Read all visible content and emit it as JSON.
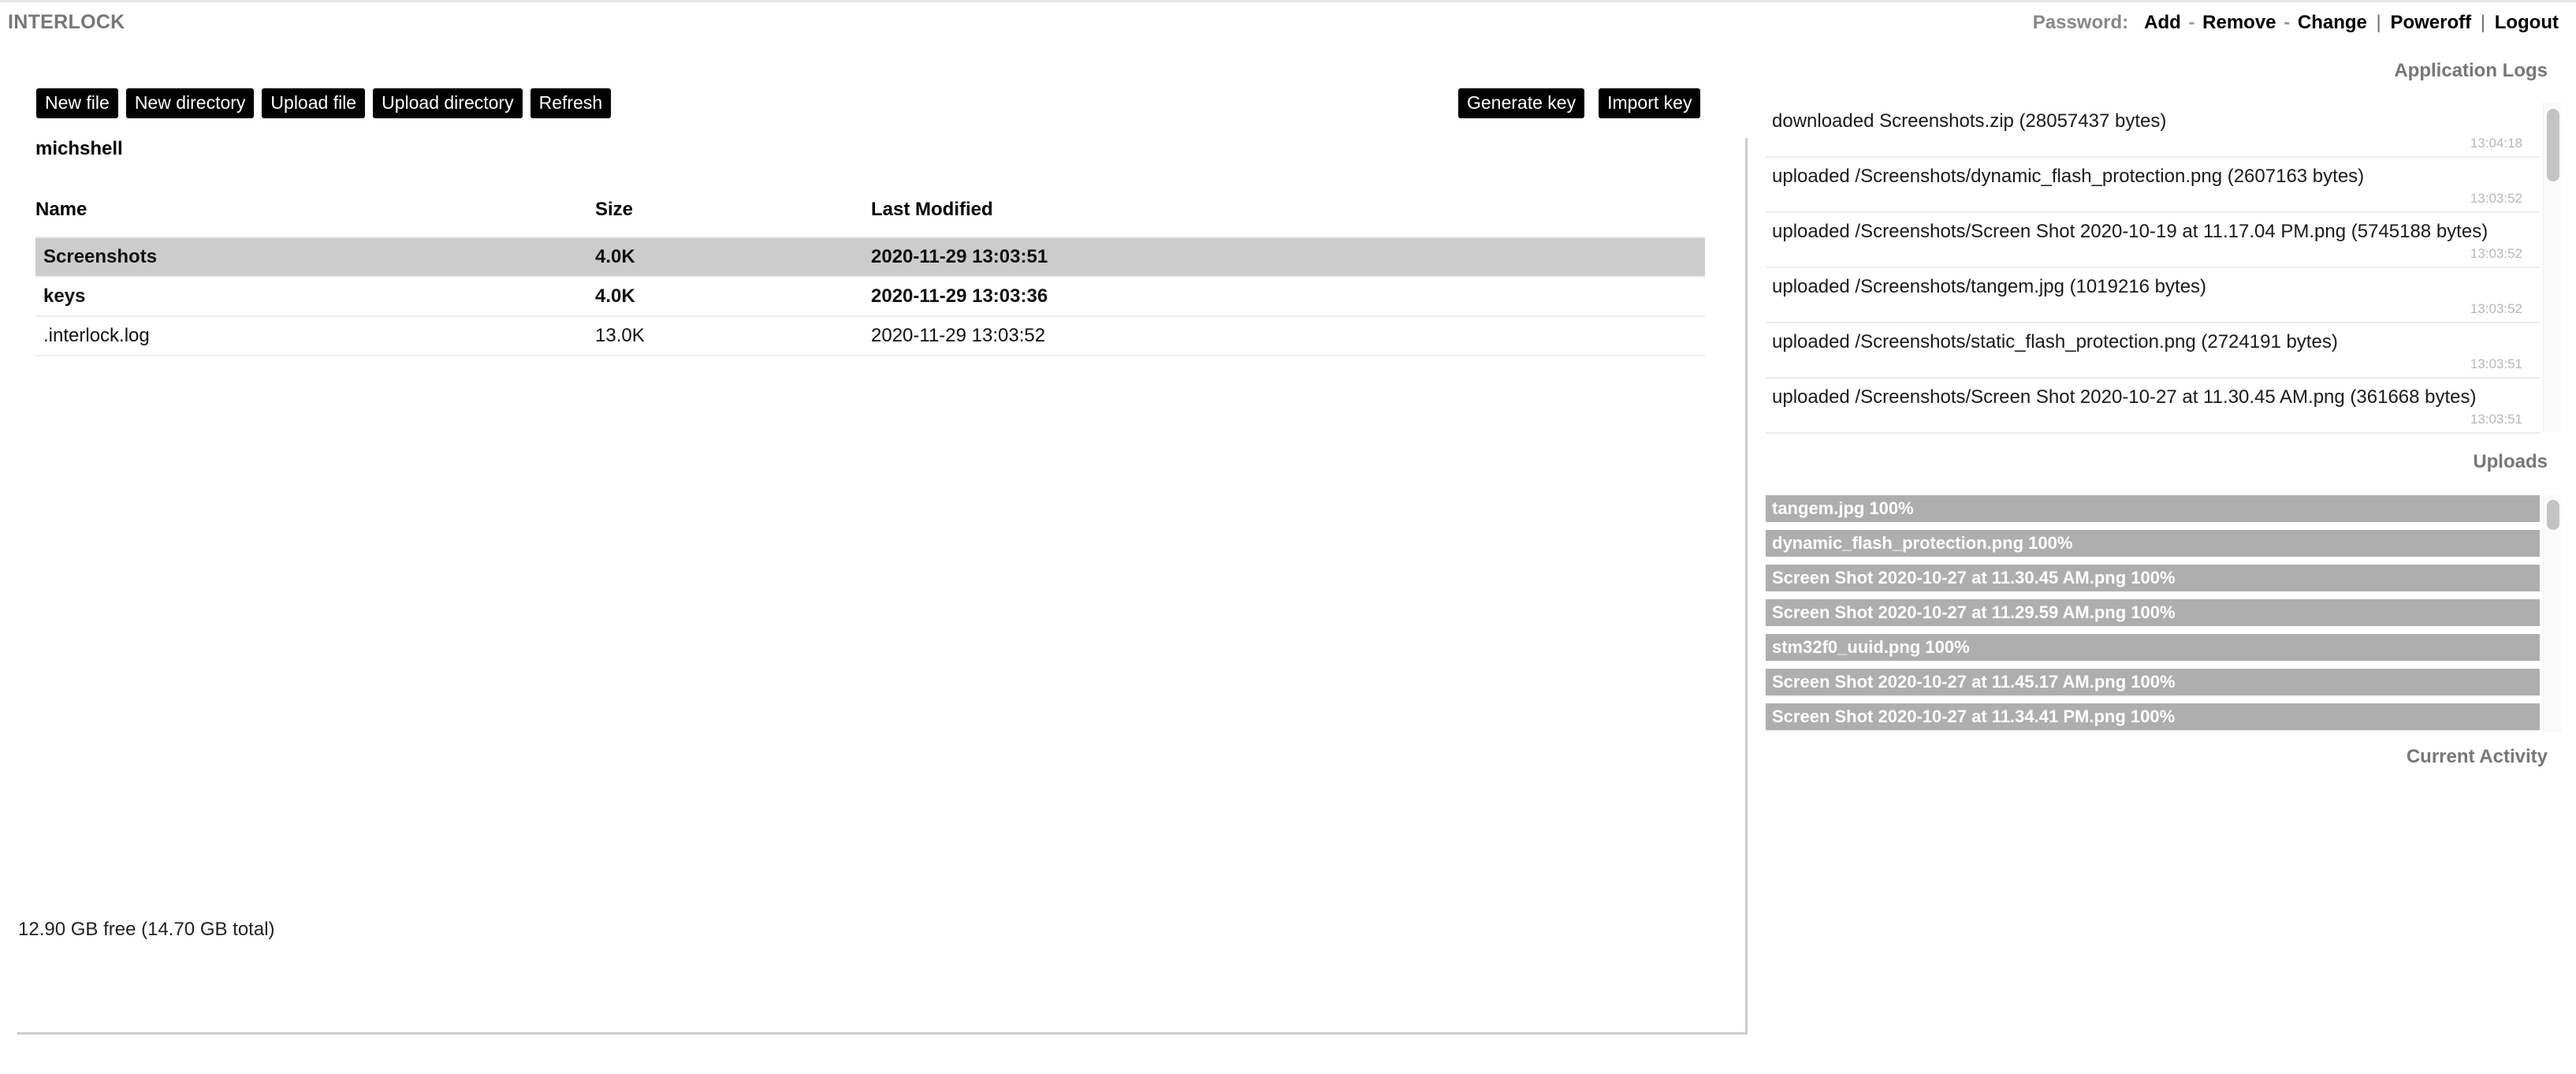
{
  "header": {
    "brand": "INTERLOCK",
    "password_label": "Password:",
    "links": {
      "add": "Add",
      "remove": "Remove",
      "change": "Change",
      "poweroff": "Poweroff",
      "logout": "Logout"
    },
    "sep_dash": "-",
    "sep_pipe": "|"
  },
  "toolbar": {
    "left": [
      {
        "label": "New file",
        "name": "new-file-button"
      },
      {
        "label": "New directory",
        "name": "new-directory-button"
      },
      {
        "label": "Upload file",
        "name": "upload-file-button"
      },
      {
        "label": "Upload directory",
        "name": "upload-directory-button"
      },
      {
        "label": "Refresh",
        "name": "refresh-button"
      }
    ],
    "right": [
      {
        "label": "Generate key",
        "name": "generate-key-button"
      },
      {
        "label": "Import key",
        "name": "import-key-button"
      }
    ]
  },
  "file_browser": {
    "path": "michshell",
    "columns": [
      "Name",
      "Size",
      "Last Modified"
    ],
    "rows": [
      {
        "name": "Screenshots",
        "size": "4.0K",
        "modified": "2020-11-29 13:03:51",
        "type": "directory",
        "selected": true
      },
      {
        "name": "keys",
        "size": "4.0K",
        "modified": "2020-11-29 13:03:36",
        "type": "directory",
        "selected": false
      },
      {
        "name": ".interlock.log",
        "size": "13.0K",
        "modified": "2020-11-29 13:03:52",
        "type": "file",
        "selected": false
      }
    ],
    "disk_status": "12.90 GB free (14.70 GB total)"
  },
  "logs": {
    "heading": "Application Logs",
    "entries": [
      {
        "message": "downloaded Screenshots.zip (28057437 bytes)",
        "time": "13:04:18"
      },
      {
        "message": "uploaded /Screenshots/dynamic_flash_protection.png (2607163 bytes)",
        "time": "13:03:52"
      },
      {
        "message": "uploaded /Screenshots/Screen Shot 2020-10-19 at 11.17.04 PM.png (5745188 bytes)",
        "time": "13:03:52"
      },
      {
        "message": "uploaded /Screenshots/tangem.jpg (1019216 bytes)",
        "time": "13:03:52"
      },
      {
        "message": "uploaded /Screenshots/static_flash_protection.png (2724191 bytes)",
        "time": "13:03:51"
      },
      {
        "message": "uploaded /Screenshots/Screen Shot 2020-10-27 at 11.30.45 AM.png (361668 bytes)",
        "time": "13:03:51"
      }
    ]
  },
  "uploads": {
    "heading": "Uploads",
    "items": [
      {
        "label": "tangem.jpg 100%",
        "percent": 100
      },
      {
        "label": "dynamic_flash_protection.png 100%",
        "percent": 100
      },
      {
        "label": "Screen Shot 2020-10-27 at 11.30.45 AM.png 100%",
        "percent": 100
      },
      {
        "label": "Screen Shot 2020-10-27 at 11.29.59 AM.png 100%",
        "percent": 100
      },
      {
        "label": "stm32f0_uuid.png 100%",
        "percent": 100
      },
      {
        "label": "Screen Shot 2020-10-27 at 11.45.17 AM.png 100%",
        "percent": 100
      },
      {
        "label": "Screen Shot 2020-10-27 at 11.34.41 PM.png 100%",
        "percent": 100
      }
    ]
  },
  "activity": {
    "heading": "Current Activity",
    "items": []
  },
  "colors": {
    "button_bg": "#000000",
    "button_fg": "#ffffff",
    "selected_row": "#cccccc",
    "progress_bar": "#aeaeae",
    "heading_gray": "#777777",
    "timestamp_gray": "#b8b8b8"
  }
}
